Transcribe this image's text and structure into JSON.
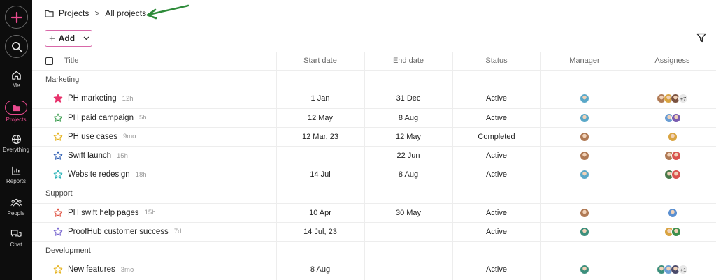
{
  "sidebar": {
    "items": [
      {
        "name": "me",
        "label": "Me"
      },
      {
        "name": "projects",
        "label": "Projects"
      },
      {
        "name": "everything",
        "label": "Everything"
      },
      {
        "name": "reports",
        "label": "Reports"
      },
      {
        "name": "people",
        "label": "People"
      },
      {
        "name": "chat",
        "label": "Chat"
      }
    ],
    "accent": "#e84a8e"
  },
  "breadcrumb": {
    "root": "Projects",
    "separator": ">",
    "current": "All projects"
  },
  "toolbar": {
    "add_label": "Add"
  },
  "table": {
    "headers": {
      "title": "Title",
      "start": "Start date",
      "end": "End date",
      "status": "Status",
      "manager": "Manager",
      "assignees": "Assigness"
    },
    "groups": [
      {
        "name": "Marketing",
        "rows": [
          {
            "title": "PH marketing",
            "age": "12h",
            "star": "filled",
            "star_color": "#e8336d",
            "start": "1 Jan",
            "end": "31 Dec",
            "status": "Active",
            "manager": [
              "#5aa8c8"
            ],
            "assignees": [
              "#b07a55",
              "#d9a441",
              "#7a5240"
            ],
            "more": "+7"
          },
          {
            "title": "PH paid campaign",
            "age": "5h",
            "star": "outline",
            "star_color": "#3a9d4e",
            "start": "12 May",
            "end": "8 Aug",
            "status": "Active",
            "manager": [
              "#5aa8c8"
            ],
            "assignees": [
              "#6b9ed4",
              "#7a5cb0"
            ],
            "more": ""
          },
          {
            "title": "PH use cases",
            "age": "9mo",
            "star": "outline",
            "star_color": "#e6b422",
            "start": "12 Mar, 23",
            "end": "12 May",
            "status": "Completed",
            "manager": [
              "#b07a55"
            ],
            "assignees": [
              "#d9a441"
            ],
            "more": ""
          },
          {
            "title": "Swift launch",
            "age": "15h",
            "star": "outline",
            "star_color": "#2f5fb3",
            "start": "",
            "end": "22 Jun",
            "status": "Active",
            "manager": [
              "#b07a55"
            ],
            "assignees": [
              "#b07a55",
              "#d9534f"
            ],
            "more": ""
          },
          {
            "title": "Website redesign",
            "age": "18h",
            "star": "outline",
            "star_color": "#2ab3b8",
            "start": "14 Jul",
            "end": "8 Aug",
            "status": "Active",
            "manager": [
              "#5aa8c8"
            ],
            "assignees": [
              "#4a7a4a",
              "#d9534f"
            ],
            "more": ""
          }
        ]
      },
      {
        "name": "Support",
        "rows": [
          {
            "title": "PH swift help pages",
            "age": "15h",
            "star": "outline",
            "star_color": "#e05545",
            "start": "10 Apr",
            "end": "30 May",
            "status": "Active",
            "manager": [
              "#b07a55"
            ],
            "assignees": [
              "#5a8fd0"
            ],
            "more": ""
          },
          {
            "title": "ProofHub customer success",
            "age": "7d",
            "star": "outline",
            "star_color": "#7d6bd1",
            "start": "14 Jul, 23",
            "end": "",
            "status": "Active",
            "manager": [
              "#3c8f7c"
            ],
            "assignees": [
              "#d9a441",
              "#3c8f4c"
            ],
            "more": ""
          }
        ]
      },
      {
        "name": "Development",
        "rows": [
          {
            "title": "New features",
            "age": "3mo",
            "star": "outline",
            "star_color": "#e6b422",
            "start": "8 Aug",
            "end": "",
            "status": "Active",
            "manager": [
              "#3c8f7c"
            ],
            "assignees": [
              "#3c8f7c",
              "#6b9ed4",
              "#4a4a6a"
            ],
            "more": "+1"
          }
        ]
      }
    ]
  }
}
